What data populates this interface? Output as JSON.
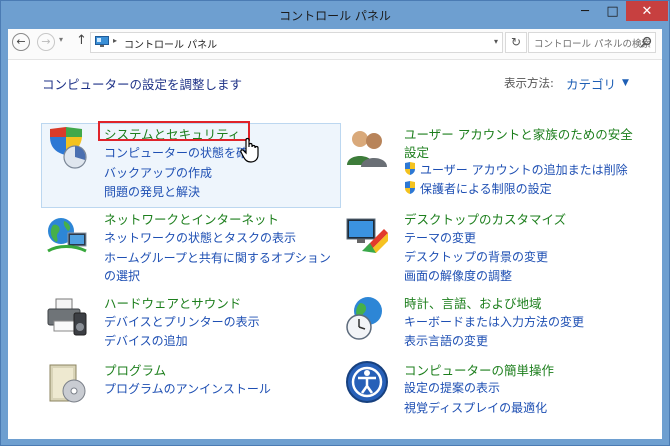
{
  "window": {
    "title": "コントロール パネル",
    "min": "─",
    "max": "□",
    "close": "✕"
  },
  "nav": {
    "back": "←",
    "forward": "→",
    "dropdown": "▾",
    "up": "↑",
    "separator": "▸",
    "address": "コントロール パネル",
    "address_dropdown": "▾",
    "refresh": "↻",
    "search_placeholder": "コントロール パネルの検索"
  },
  "header": {
    "title": "コンピューターの設定を調整します",
    "view_by_label": "表示方法:",
    "view_by_value": "カテゴリ",
    "view_by_caret": "▼"
  },
  "categories": [
    {
      "title": "システムとセキュリティ",
      "icon": "shield-chart-icon",
      "links": [
        "コンピューターの状態を確",
        "バックアップの作成",
        "問題の発見と解決"
      ]
    },
    {
      "title": "ネットワークとインターネット",
      "icon": "network-globe-icon",
      "links": [
        "ネットワークの状態とタスクの表示",
        "ホームグループと共有に関するオプション",
        "の選択"
      ]
    },
    {
      "title": "ハードウェアとサウンド",
      "icon": "printer-speaker-icon",
      "links": [
        "デバイスとプリンターの表示",
        "デバイスの追加"
      ]
    },
    {
      "title": "プログラム",
      "icon": "program-box-icon",
      "links": [
        "プログラムのアンインストール"
      ]
    },
    {
      "title": "ユーザー アカウントと家族のための安全",
      "title2": "設定",
      "icon": "users-icon",
      "links": [
        "ユーザー アカウントの追加または削除",
        "保護者による制限の設定"
      ]
    },
    {
      "title": "デスクトップのカスタマイズ",
      "icon": "monitor-palette-icon",
      "links": [
        "テーマの変更",
        "デスクトップの背景の変更",
        "画面の解像度の調整"
      ]
    },
    {
      "title": "時計、言語、および地域",
      "icon": "clock-globe-icon",
      "links": [
        "キーボードまたは入力方法の変更",
        "表示言語の変更"
      ]
    },
    {
      "title": "コンピューターの簡単操作",
      "icon": "ease-of-access-icon",
      "links": [
        "設定の提案の表示",
        "視覚ディスプレイの最適化"
      ]
    }
  ],
  "colors": {
    "category_title": "#1d7f1d",
    "link": "#1e4fb3",
    "header_title": "#1e3287",
    "selection_border": "#e0232a",
    "titlebar": "#6e9fd0"
  }
}
